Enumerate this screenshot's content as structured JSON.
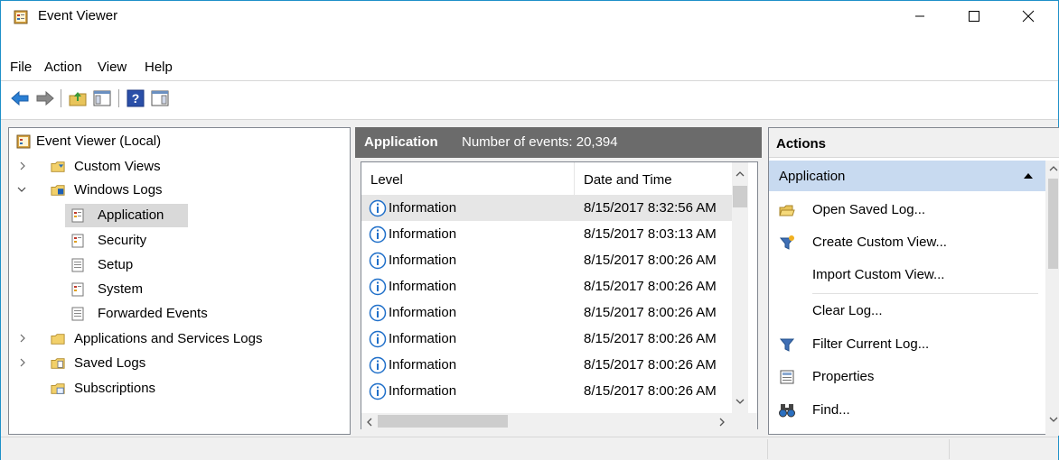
{
  "window": {
    "title": "Event Viewer",
    "controls": {
      "minimize": "minimize",
      "maximize": "maximize",
      "close": "close"
    }
  },
  "menu": [
    "File",
    "Action",
    "View",
    "Help"
  ],
  "toolbar": {
    "buttons": [
      "back-arrow-icon",
      "forward-arrow-icon",
      "up-folder-icon",
      "show-hide-console-tree-icon",
      "help-icon",
      "show-hide-action-pane-icon"
    ]
  },
  "tree": {
    "root": "Event Viewer (Local)",
    "items": [
      {
        "label": "Custom Views",
        "level": 1,
        "expanded": false
      },
      {
        "label": "Windows Logs",
        "level": 1,
        "expanded": true
      },
      {
        "label": "Application",
        "level": 2,
        "selected": true
      },
      {
        "label": "Security",
        "level": 2
      },
      {
        "label": "Setup",
        "level": 2
      },
      {
        "label": "System",
        "level": 2
      },
      {
        "label": "Forwarded Events",
        "level": 2
      },
      {
        "label": "Applications and Services Logs",
        "level": 1,
        "expanded": false
      },
      {
        "label": "Saved Logs",
        "level": 1,
        "expanded": false
      },
      {
        "label": "Subscriptions",
        "level": 1
      }
    ]
  },
  "events": {
    "header_title": "Application",
    "header_count": "Number of events: 20,394",
    "columns": [
      "Level",
      "Date and Time"
    ],
    "rows": [
      {
        "level": "Information",
        "datetime": "8/15/2017 8:32:56 AM"
      },
      {
        "level": "Information",
        "datetime": "8/15/2017 8:03:13 AM"
      },
      {
        "level": "Information",
        "datetime": "8/15/2017 8:00:26 AM"
      },
      {
        "level": "Information",
        "datetime": "8/15/2017 8:00:26 AM"
      },
      {
        "level": "Information",
        "datetime": "8/15/2017 8:00:26 AM"
      },
      {
        "level": "Information",
        "datetime": "8/15/2017 8:00:26 AM"
      },
      {
        "level": "Information",
        "datetime": "8/15/2017 8:00:26 AM"
      },
      {
        "level": "Information",
        "datetime": "8/15/2017 8:00:26 AM"
      }
    ]
  },
  "actions": {
    "title": "Actions",
    "section": "Application",
    "items": [
      {
        "label": "Open Saved Log...",
        "icon": "open-folder-icon"
      },
      {
        "label": "Create Custom View...",
        "icon": "funnel-star-icon"
      },
      {
        "label": "Import Custom View...",
        "icon": ""
      },
      {
        "label": "Clear Log...",
        "icon": ""
      },
      {
        "label": "Filter Current Log...",
        "icon": "funnel-icon"
      },
      {
        "label": "Properties",
        "icon": "properties-icon"
      },
      {
        "label": "Find...",
        "icon": "binoculars-icon"
      }
    ]
  },
  "colors": {
    "window_border": "#1e90c8",
    "header_bg": "#6b6b6b",
    "action_section_bg": "#c8daf0",
    "info_blue": "#1f6fc9"
  }
}
